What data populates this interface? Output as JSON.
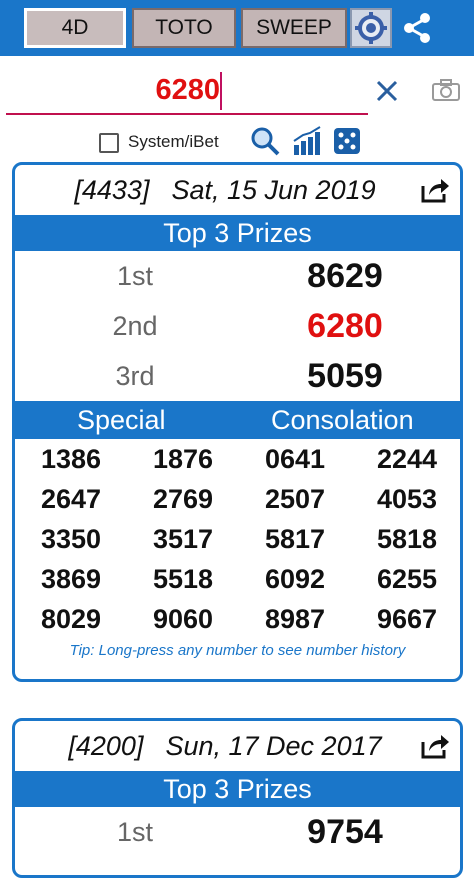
{
  "tabs": [
    {
      "label": "4D",
      "active": true
    },
    {
      "label": "TOTO",
      "active": false
    },
    {
      "label": "SWEEP",
      "active": false
    }
  ],
  "icons": {
    "settings": "gear-icon",
    "share": "share-icon",
    "clear": "close-icon",
    "camera": "camera-icon",
    "search": "search-icon",
    "chart": "chart-icon",
    "dice": "dice-icon",
    "card_share": "share-arrow-icon"
  },
  "colors": {
    "primary": "#1a76c9",
    "highlight": "#e01010",
    "tab_bg": "#c3b5b5"
  },
  "search": {
    "value": "6280"
  },
  "options": {
    "system_ibet_label": "System/iBet",
    "system_ibet_checked": false
  },
  "results": [
    {
      "draw_no": "[4433]",
      "date": "Sat, 15 Jun 2019",
      "top_label": "Top 3 Prizes",
      "prizes": [
        {
          "label": "1st",
          "number": "8629",
          "highlight": false
        },
        {
          "label": "2nd",
          "number": "6280",
          "highlight": true
        },
        {
          "label": "3rd",
          "number": "5059",
          "highlight": false
        }
      ],
      "special_label": "Special",
      "consolation_label": "Consolation",
      "special": [
        "1386",
        "1876",
        "2647",
        "2769",
        "3350",
        "3517",
        "3869",
        "5518",
        "8029",
        "9060"
      ],
      "consolation": [
        "0641",
        "2244",
        "2507",
        "4053",
        "5817",
        "5818",
        "6092",
        "6255",
        "8987",
        "9667"
      ],
      "tip": "Tip: Long-press any number to see number history"
    },
    {
      "draw_no": "[4200]",
      "date": "Sun, 17 Dec 2017",
      "top_label": "Top 3 Prizes",
      "prizes": [
        {
          "label": "1st",
          "number": "9754",
          "highlight": false
        }
      ]
    }
  ]
}
